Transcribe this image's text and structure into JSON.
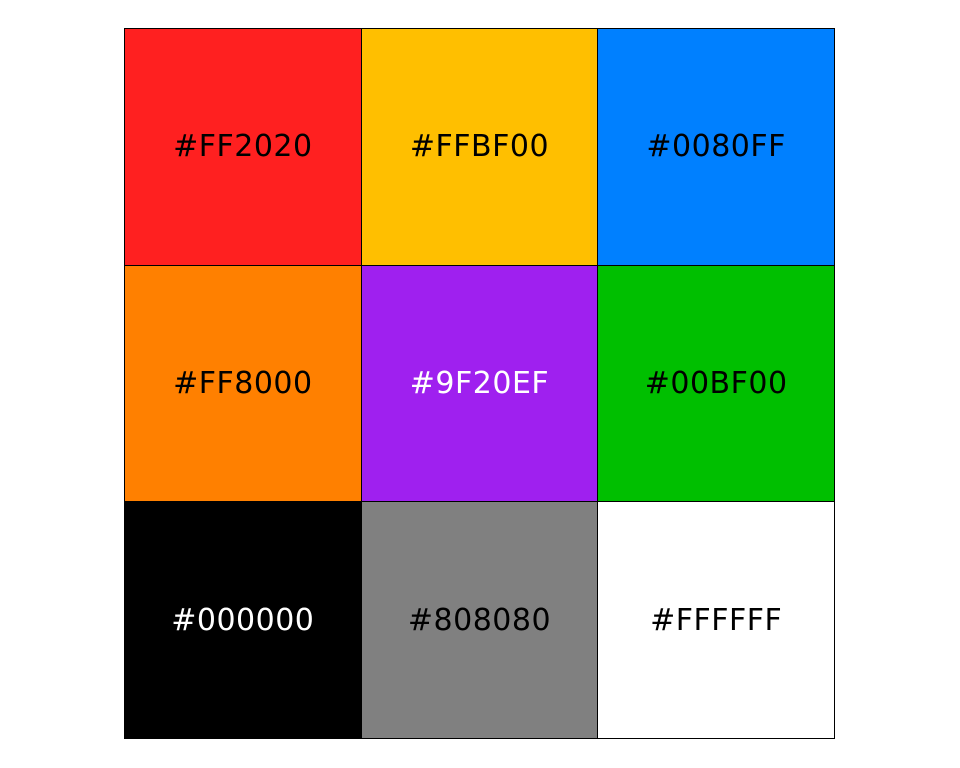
{
  "swatches": [
    {
      "label": "#FF2020",
      "color": "#FF2020",
      "text_color": "#000000"
    },
    {
      "label": "#FFBF00",
      "color": "#FFBF00",
      "text_color": "#000000"
    },
    {
      "label": "#0080FF",
      "color": "#0080FF",
      "text_color": "#000000"
    },
    {
      "label": "#FF8000",
      "color": "#FF8000",
      "text_color": "#000000"
    },
    {
      "label": "#9F20EF",
      "color": "#9F20EF",
      "text_color": "#FFFFFF"
    },
    {
      "label": "#00BF00",
      "color": "#00BF00",
      "text_color": "#000000"
    },
    {
      "label": "#000000",
      "color": "#000000",
      "text_color": "#FFFFFF"
    },
    {
      "label": "#808080",
      "color": "#808080",
      "text_color": "#000000"
    },
    {
      "label": "#FFFFFF",
      "color": "#FFFFFF",
      "text_color": "#000000"
    }
  ]
}
